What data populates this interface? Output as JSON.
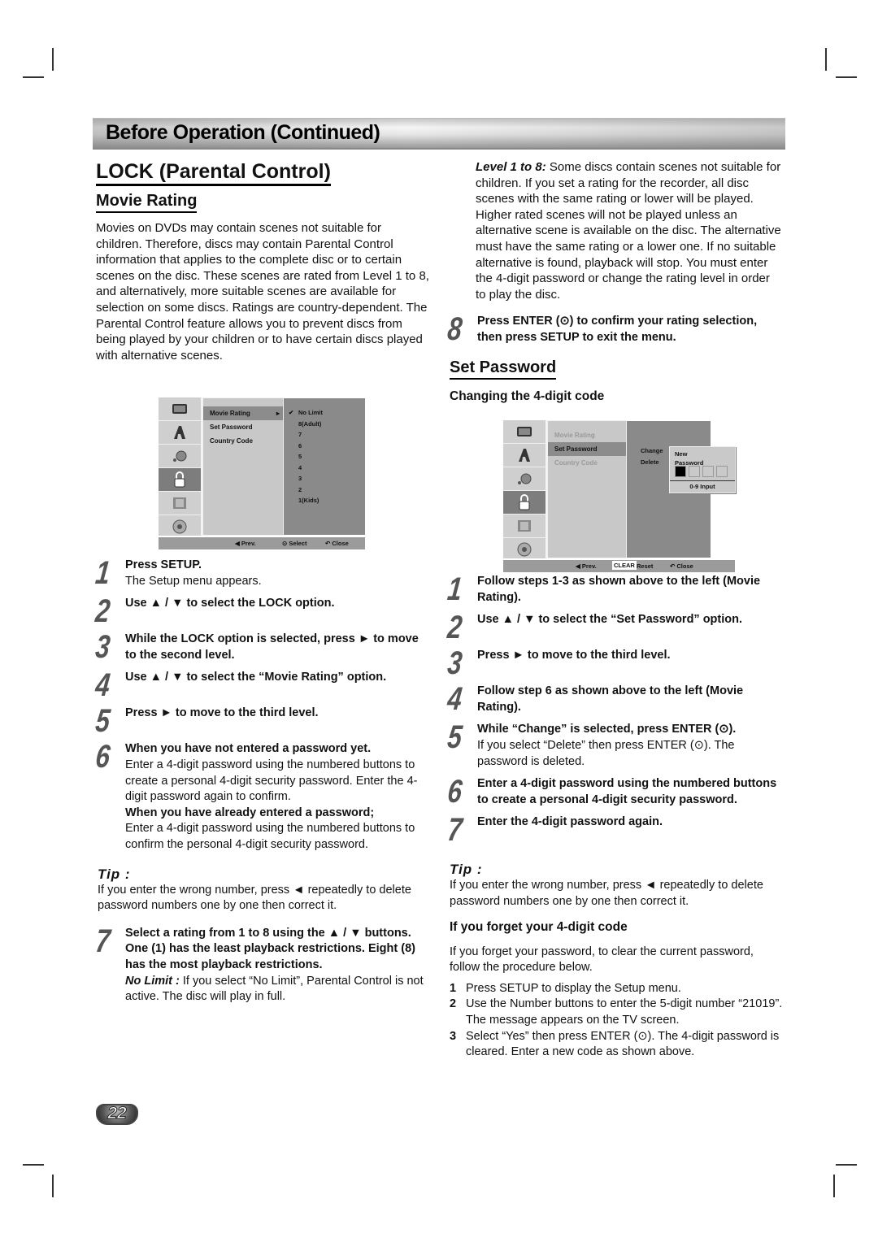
{
  "banner": {
    "title": "Before Operation (Continued)"
  },
  "left": {
    "title": "LOCK (Parental Control)",
    "section": "Movie Rating",
    "intro": "Movies on DVDs may contain scenes not suitable for children. Therefore, discs may contain Parental Control information that applies to the complete disc or to certain scenes on the disc. These scenes are rated from Level 1 to 8, and alternatively, more suitable scenes are available for selection on some discs. Ratings are country-dependent. The Parental Control feature allows you to prevent discs from being played by your children or to have certain discs played with alternative scenes.",
    "menu": {
      "items": [
        "Movie Rating",
        "Set Password",
        "Country Code"
      ],
      "options": [
        "No Limit",
        "8(Adult)",
        "7",
        "6",
        "5",
        "4",
        "3",
        "2",
        "1(Kids)"
      ],
      "checked": "No Limit",
      "bar": {
        "prev": "Prev.",
        "select": "Select",
        "close": "Close"
      }
    },
    "steps": [
      {
        "n": "1",
        "title": "Press SETUP.",
        "body": "The Setup menu appears."
      },
      {
        "n": "2",
        "title": "Use ▲ / ▼ to select the LOCK option.",
        "body": ""
      },
      {
        "n": "3",
        "title": "While the LOCK option is selected, press ► to move to the second level.",
        "body": ""
      },
      {
        "n": "4",
        "title": "Use ▲ / ▼ to select the “Movie Rating” option.",
        "body": ""
      },
      {
        "n": "5",
        "title": "Press ► to move to the third level.",
        "body": ""
      },
      {
        "n": "6",
        "title": "When you have not entered a password yet.",
        "body": "Enter a 4-digit password using the numbered buttons to create a personal 4-digit security password. Enter the 4-digit password again to confirm.",
        "title2": "When you have already entered a password;",
        "body2": "Enter a 4-digit password using the numbered buttons to confirm the personal 4-digit security password."
      }
    ],
    "tip": {
      "heading": "Tip :",
      "text": "If you enter the wrong number, press ◄ repeatedly to delete password numbers one by one then correct it."
    },
    "step7": {
      "n": "7",
      "title": "Select a rating from 1 to 8 using the ▲ / ▼ buttons. One (1) has the least playback restrictions. Eight (8) has the most playback restrictions.",
      "label": "No Limit :",
      "body": " If you select “No Limit”, Parental Control is not active. The disc will play in full."
    }
  },
  "right": {
    "level_label": "Level 1 to 8:",
    "level_text": " Some discs contain scenes not suitable for children. If you set a rating for the recorder, all disc scenes with the same rating or lower will be played. Higher rated scenes will not be played unless an alternative scene is available on the disc. The alternative must have the same rating or a lower one. If no suitable alternative is found, playback will stop. You must enter the 4-digit password or change the rating level in order to play the disc.",
    "step8": {
      "n": "8",
      "title": "Press ENTER (⊙) to confirm your rating selection, then press SETUP to exit the menu."
    },
    "section": "Set Password",
    "subsection": "Changing the 4-digit code",
    "menu": {
      "items": [
        "Movie Rating",
        "Set Password",
        "Country Code"
      ],
      "options": [
        "Change",
        "Delete"
      ],
      "popup_title": "New Password",
      "popup_hint": "0-9 Input",
      "digits_entered": 1,
      "digits_total": 4,
      "bar": {
        "prev": "Prev.",
        "clear": "CLEAR",
        "reset": "Reset",
        "close": "Close"
      }
    },
    "steps": [
      {
        "n": "1",
        "title": "Follow steps 1-3 as shown above to the left (Movie Rating).",
        "body": ""
      },
      {
        "n": "2",
        "title": "Use ▲ / ▼ to select the “Set Password” option.",
        "body": ""
      },
      {
        "n": "3",
        "title": "Press ► to move to the third level.",
        "body": ""
      },
      {
        "n": "4",
        "title": "Follow step 6 as shown above to the left (Movie Rating).",
        "body": ""
      },
      {
        "n": "5",
        "title": "While “Change” is selected, press ENTER (⊙).",
        "body": "If you select “Delete” then press ENTER (⊙). The password is deleted."
      },
      {
        "n": "6",
        "title": "Enter a 4-digit password using the numbered buttons to create a personal 4-digit security password.",
        "body": ""
      },
      {
        "n": "7",
        "title": "Enter the 4-digit password again.",
        "body": ""
      }
    ],
    "tip": {
      "heading": "Tip :",
      "text": "If you enter the wrong number, press ◄ repeatedly to delete password numbers one by one then correct it."
    },
    "forget": {
      "heading": "If you forget your 4-digit code",
      "intro": "If you forget your password, to clear the current password, follow the procedure below.",
      "items": [
        {
          "n": "1",
          "text": "Press SETUP to display the Setup menu."
        },
        {
          "n": "2",
          "text": "Use the Number buttons to enter the 5-digit number “21019”.",
          "extra": "The message appears on the TV screen."
        },
        {
          "n": "3",
          "text": "Select “Yes” then press ENTER (⊙). The 4-digit password is cleared. Enter a new code as shown above."
        }
      ]
    }
  },
  "page_number": "22"
}
